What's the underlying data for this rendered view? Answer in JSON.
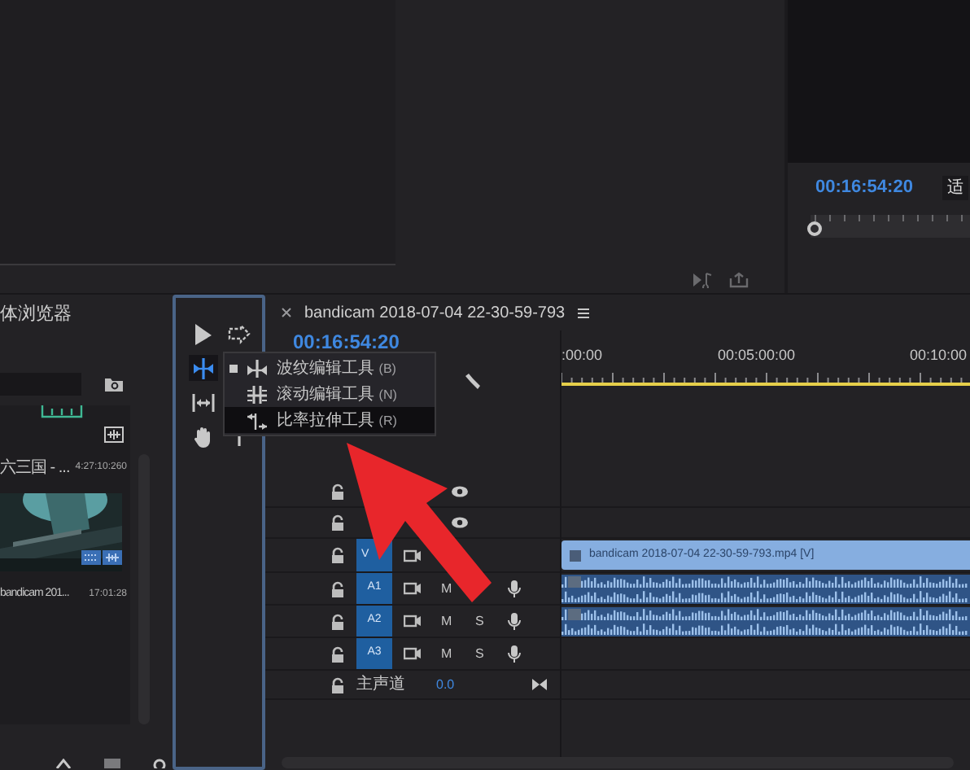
{
  "program_monitor": {
    "timecode": "00:16:54:20",
    "fit_label": "适"
  },
  "project_panel": {
    "title": "体浏览器",
    "items": [
      {
        "kind": "partial",
        "name": "六三国 - ...",
        "duration": "4:27:10:260"
      },
      {
        "kind": "thumbnail",
        "name": "bandicam 201...",
        "duration": "17:01:28"
      }
    ]
  },
  "tool_rows": [
    {
      "tools": [
        {
          "kind": "selection",
          "selected": false
        },
        {
          "kind": "track-select",
          "selected": false
        }
      ]
    },
    {
      "tools": [
        {
          "kind": "ripple",
          "selected": true
        }
      ]
    },
    {
      "tools": [
        {
          "kind": "slip",
          "selected": false
        }
      ]
    },
    {
      "tools": [
        {
          "kind": "hand",
          "selected": false
        },
        {
          "kind": "type",
          "selected": false
        }
      ]
    }
  ],
  "tool_menu": [
    {
      "kind": "ripple",
      "label": "波纹编辑工具",
      "shortcut": "(B)",
      "current": true,
      "highlighted": false
    },
    {
      "kind": "rolling",
      "label": "滚动编辑工具",
      "shortcut": "(N)",
      "current": false,
      "highlighted": false
    },
    {
      "kind": "rate",
      "label": "比率拉伸工具",
      "shortcut": "(R)",
      "current": false,
      "highlighted": true
    }
  ],
  "timeline": {
    "tab_title": "bandicam 2018-07-04 22-30-59-793",
    "timecode": "00:16:54:20",
    "ruler": [
      ":00:00",
      "00:05:00:00",
      "00:10:00"
    ],
    "tracks": [
      {
        "kind": "video",
        "eye": true
      },
      {
        "kind": "video",
        "eye": true
      },
      {
        "kind": "video",
        "target": "V",
        "clip": "bandicam 2018-07-04 22-30-59-793.mp4 [V]"
      },
      {
        "kind": "audio",
        "target": "A1",
        "mute": "M",
        "has_clip": true
      },
      {
        "kind": "audio",
        "target": "A2",
        "mute": "M",
        "solo": "S",
        "has_clip": true
      },
      {
        "kind": "audio",
        "target": "A3",
        "mute": "M",
        "solo": "S"
      },
      {
        "kind": "master",
        "label": "主声道",
        "value": "0.0"
      }
    ]
  }
}
